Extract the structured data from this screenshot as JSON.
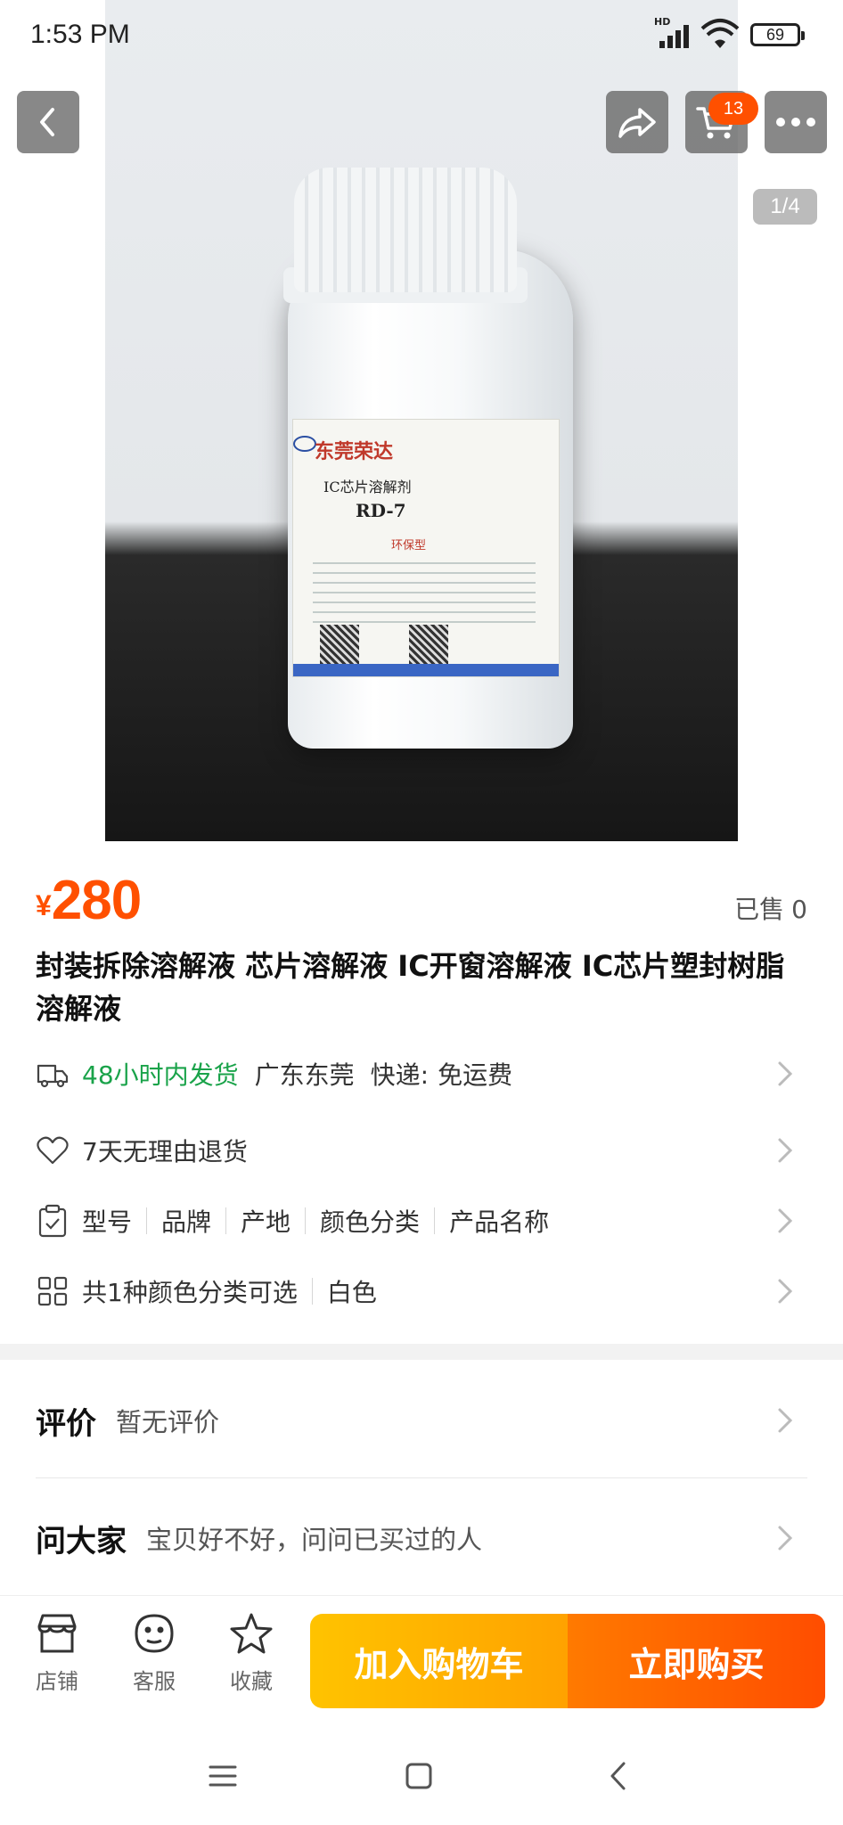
{
  "status_bar": {
    "time": "1:53 PM",
    "network": "HD",
    "battery": "69"
  },
  "gallery": {
    "indicator": "1/4",
    "cart_count": "13",
    "photo_label": {
      "brand": "东莞荣达",
      "line1": "IC芯片溶解剂",
      "model": "RD-7",
      "tag": "环保型",
      "logo": "RD"
    }
  },
  "product": {
    "currency": "¥",
    "price": "280",
    "sold_label": "已售",
    "sold_count": "0",
    "title": "封装拆除溶解液 芯片溶解液 IC开窗溶解液 IC芯片塑封树脂溶解液"
  },
  "shipping": {
    "time": "48小时内发货",
    "location": "广东东莞",
    "courier": "快递:",
    "fee": "免运费"
  },
  "returns": {
    "label": "7天无理由退货"
  },
  "params": {
    "items": [
      "型号",
      "品牌",
      "产地",
      "颜色分类",
      "产品名称"
    ]
  },
  "variants": {
    "count_label": "共1种颜色分类可选",
    "value": "白色"
  },
  "reviews": {
    "heading": "评价",
    "summary": "暂无评价"
  },
  "qa": {
    "heading": "问大家",
    "prompt": "宝贝好不好，问问已买过的人"
  },
  "bottom_bar": {
    "store": "店铺",
    "service": "客服",
    "favorite": "收藏",
    "add_to_cart": "加入购物车",
    "buy_now": "立即购买"
  },
  "colors": {
    "accent": "#ff5000",
    "green": "#1aa34a",
    "cart_btn": "#ffb000",
    "buy_btn": "#ff5a00"
  }
}
